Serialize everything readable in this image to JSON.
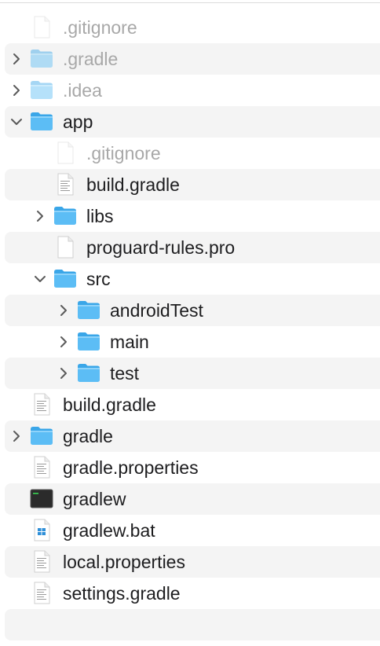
{
  "items": [
    {
      "label": ".gitignore",
      "depth": 0,
      "type": "file",
      "icon": "document-icon",
      "dimmed": true,
      "alt": false,
      "chevron": "none"
    },
    {
      "label": ".gradle",
      "depth": 0,
      "type": "folder",
      "icon": "folder-icon",
      "dimmed": true,
      "alt": true,
      "chevron": "collapsed"
    },
    {
      "label": ".idea",
      "depth": 0,
      "type": "folder",
      "icon": "folder-icon",
      "dimmed": true,
      "alt": false,
      "chevron": "collapsed"
    },
    {
      "label": "app",
      "depth": 0,
      "type": "folder",
      "icon": "folder-icon",
      "dimmed": false,
      "alt": true,
      "chevron": "expanded"
    },
    {
      "label": ".gitignore",
      "depth": 1,
      "type": "file",
      "icon": "document-icon",
      "dimmed": true,
      "alt": false,
      "chevron": "none"
    },
    {
      "label": "build.gradle",
      "depth": 1,
      "type": "file",
      "icon": "text-document-icon",
      "dimmed": false,
      "alt": true,
      "chevron": "none"
    },
    {
      "label": "libs",
      "depth": 1,
      "type": "folder",
      "icon": "folder-icon",
      "dimmed": false,
      "alt": false,
      "chevron": "collapsed"
    },
    {
      "label": "proguard-rules.pro",
      "depth": 1,
      "type": "file",
      "icon": "document-icon",
      "dimmed": false,
      "alt": true,
      "chevron": "none"
    },
    {
      "label": "src",
      "depth": 1,
      "type": "folder",
      "icon": "folder-icon",
      "dimmed": false,
      "alt": false,
      "chevron": "expanded"
    },
    {
      "label": "androidTest",
      "depth": 2,
      "type": "folder",
      "icon": "folder-icon",
      "dimmed": false,
      "alt": true,
      "chevron": "collapsed"
    },
    {
      "label": "main",
      "depth": 2,
      "type": "folder",
      "icon": "folder-icon",
      "dimmed": false,
      "alt": false,
      "chevron": "collapsed"
    },
    {
      "label": "test",
      "depth": 2,
      "type": "folder",
      "icon": "folder-icon",
      "dimmed": false,
      "alt": true,
      "chevron": "collapsed"
    },
    {
      "label": "build.gradle",
      "depth": 0,
      "type": "file",
      "icon": "text-document-icon",
      "dimmed": false,
      "alt": false,
      "chevron": "none"
    },
    {
      "label": "gradle",
      "depth": 0,
      "type": "folder",
      "icon": "folder-icon",
      "dimmed": false,
      "alt": true,
      "chevron": "collapsed"
    },
    {
      "label": "gradle.properties",
      "depth": 0,
      "type": "file",
      "icon": "text-document-icon",
      "dimmed": false,
      "alt": false,
      "chevron": "none"
    },
    {
      "label": "gradlew",
      "depth": 0,
      "type": "exec",
      "icon": "terminal-executable-icon",
      "dimmed": false,
      "alt": true,
      "chevron": "none"
    },
    {
      "label": "gradlew.bat",
      "depth": 0,
      "type": "bat",
      "icon": "windows-batch-file-icon",
      "dimmed": false,
      "alt": false,
      "chevron": "none"
    },
    {
      "label": "local.properties",
      "depth": 0,
      "type": "file",
      "icon": "text-document-icon",
      "dimmed": false,
      "alt": true,
      "chevron": "none"
    },
    {
      "label": "settings.gradle",
      "depth": 0,
      "type": "file",
      "icon": "text-document-icon",
      "dimmed": false,
      "alt": false,
      "chevron": "none"
    },
    {
      "label": "",
      "depth": 0,
      "type": "empty",
      "icon": "",
      "dimmed": false,
      "alt": true,
      "chevron": "none"
    }
  ],
  "colors": {
    "folder_body": "#5cbdf5",
    "folder_tab": "#3aa6e8",
    "row_alt": "#f4f4f4",
    "text": "#1d1d1f",
    "text_dim": "#a8a8a8"
  }
}
